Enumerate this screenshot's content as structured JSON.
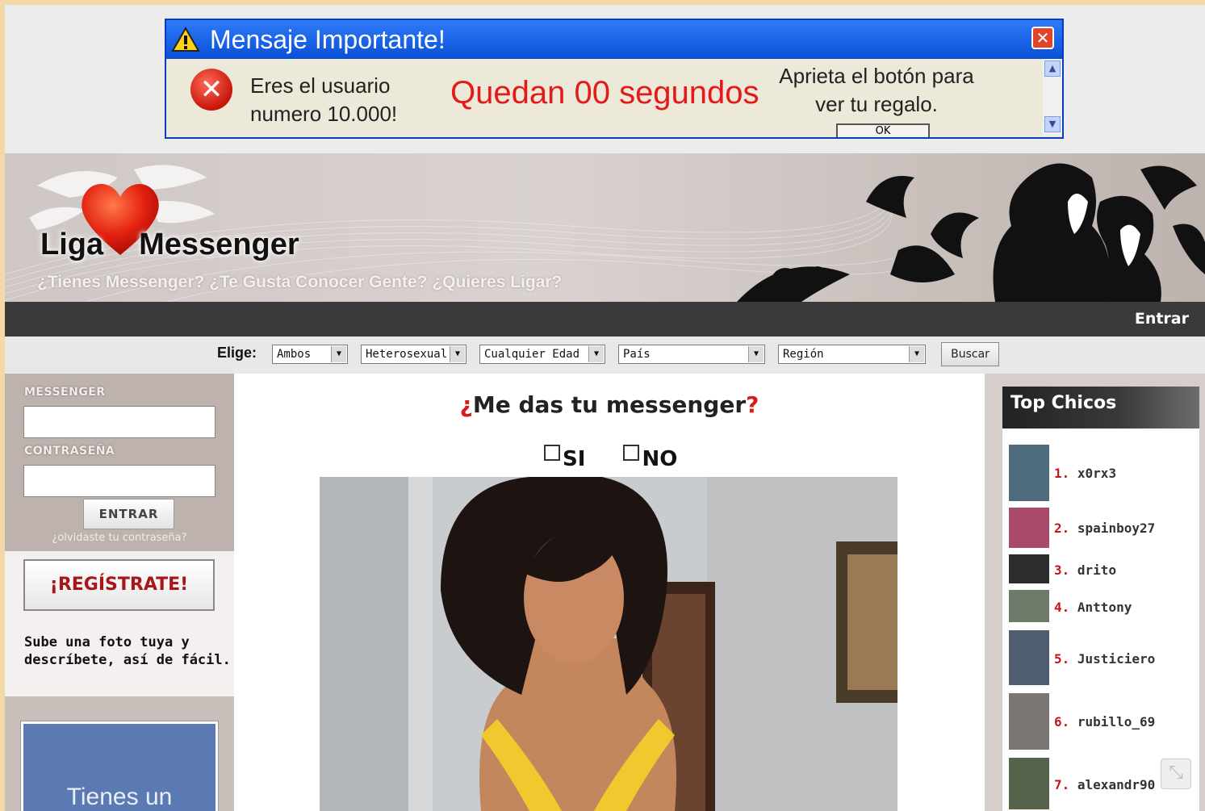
{
  "ad": {
    "title": "Mensaje Importante!",
    "close_glyph": "✕",
    "error_glyph": "✕",
    "message_line1": "Eres el usuario",
    "message_line2": "numero 10.000!",
    "countdown": "Quedan 00 segundos",
    "hint_line1": "Aprieta el botón para",
    "hint_line2": "ver tu regalo.",
    "ok_label": "OK",
    "scroll_up": "▲",
    "scroll_down": "▼"
  },
  "header": {
    "logo_left": "Liga",
    "logo_right": "Messenger",
    "tagline": "¿Tienes Messenger? ¿Te Gusta Conocer Gente? ¿Quieres Ligar?"
  },
  "navbar": {
    "enter_label": "Entrar"
  },
  "filters": {
    "label": "Elige:",
    "gender": "Ambos",
    "orientation": "Heterosexual",
    "age": "Cualquier Edad",
    "country": "País",
    "region": "Región",
    "dropdown_arrow": "▼",
    "search_label": "Buscar"
  },
  "login": {
    "messenger_label": "MESSENGER",
    "password_label": "CONTRASEÑA",
    "messenger_value": "",
    "password_value": "",
    "submit_label": "ENTRAR",
    "forgot_label": "¿olvidaste tu contraseña?"
  },
  "register": {
    "button_label": "¡REGÍSTRATE!",
    "note_line1": "Sube una foto tuya y",
    "note_line2": "descríbete, así de fácil."
  },
  "promo": {
    "text": "Tienes un"
  },
  "main": {
    "question_mark_open": "¿",
    "question_text": "Me das tu messenger",
    "question_mark_close": "?",
    "option_yes": "SI",
    "option_no": "NO"
  },
  "top_chicos": {
    "title": "Top Chicos",
    "items": [
      {
        "rank": "1.",
        "name": "x0rx3"
      },
      {
        "rank": "2.",
        "name": "spainboy27"
      },
      {
        "rank": "3.",
        "name": "drito"
      },
      {
        "rank": "4.",
        "name": "Anttony"
      },
      {
        "rank": "5.",
        "name": "Justiciero"
      },
      {
        "rank": "6.",
        "name": "rubillo_69"
      },
      {
        "rank": "7.",
        "name": "alexandr90"
      }
    ]
  },
  "colors": {
    "accent_red": "#d61d1d",
    "brand_blue": "#0a4fd8",
    "nav_dark": "#3a3a3a"
  }
}
